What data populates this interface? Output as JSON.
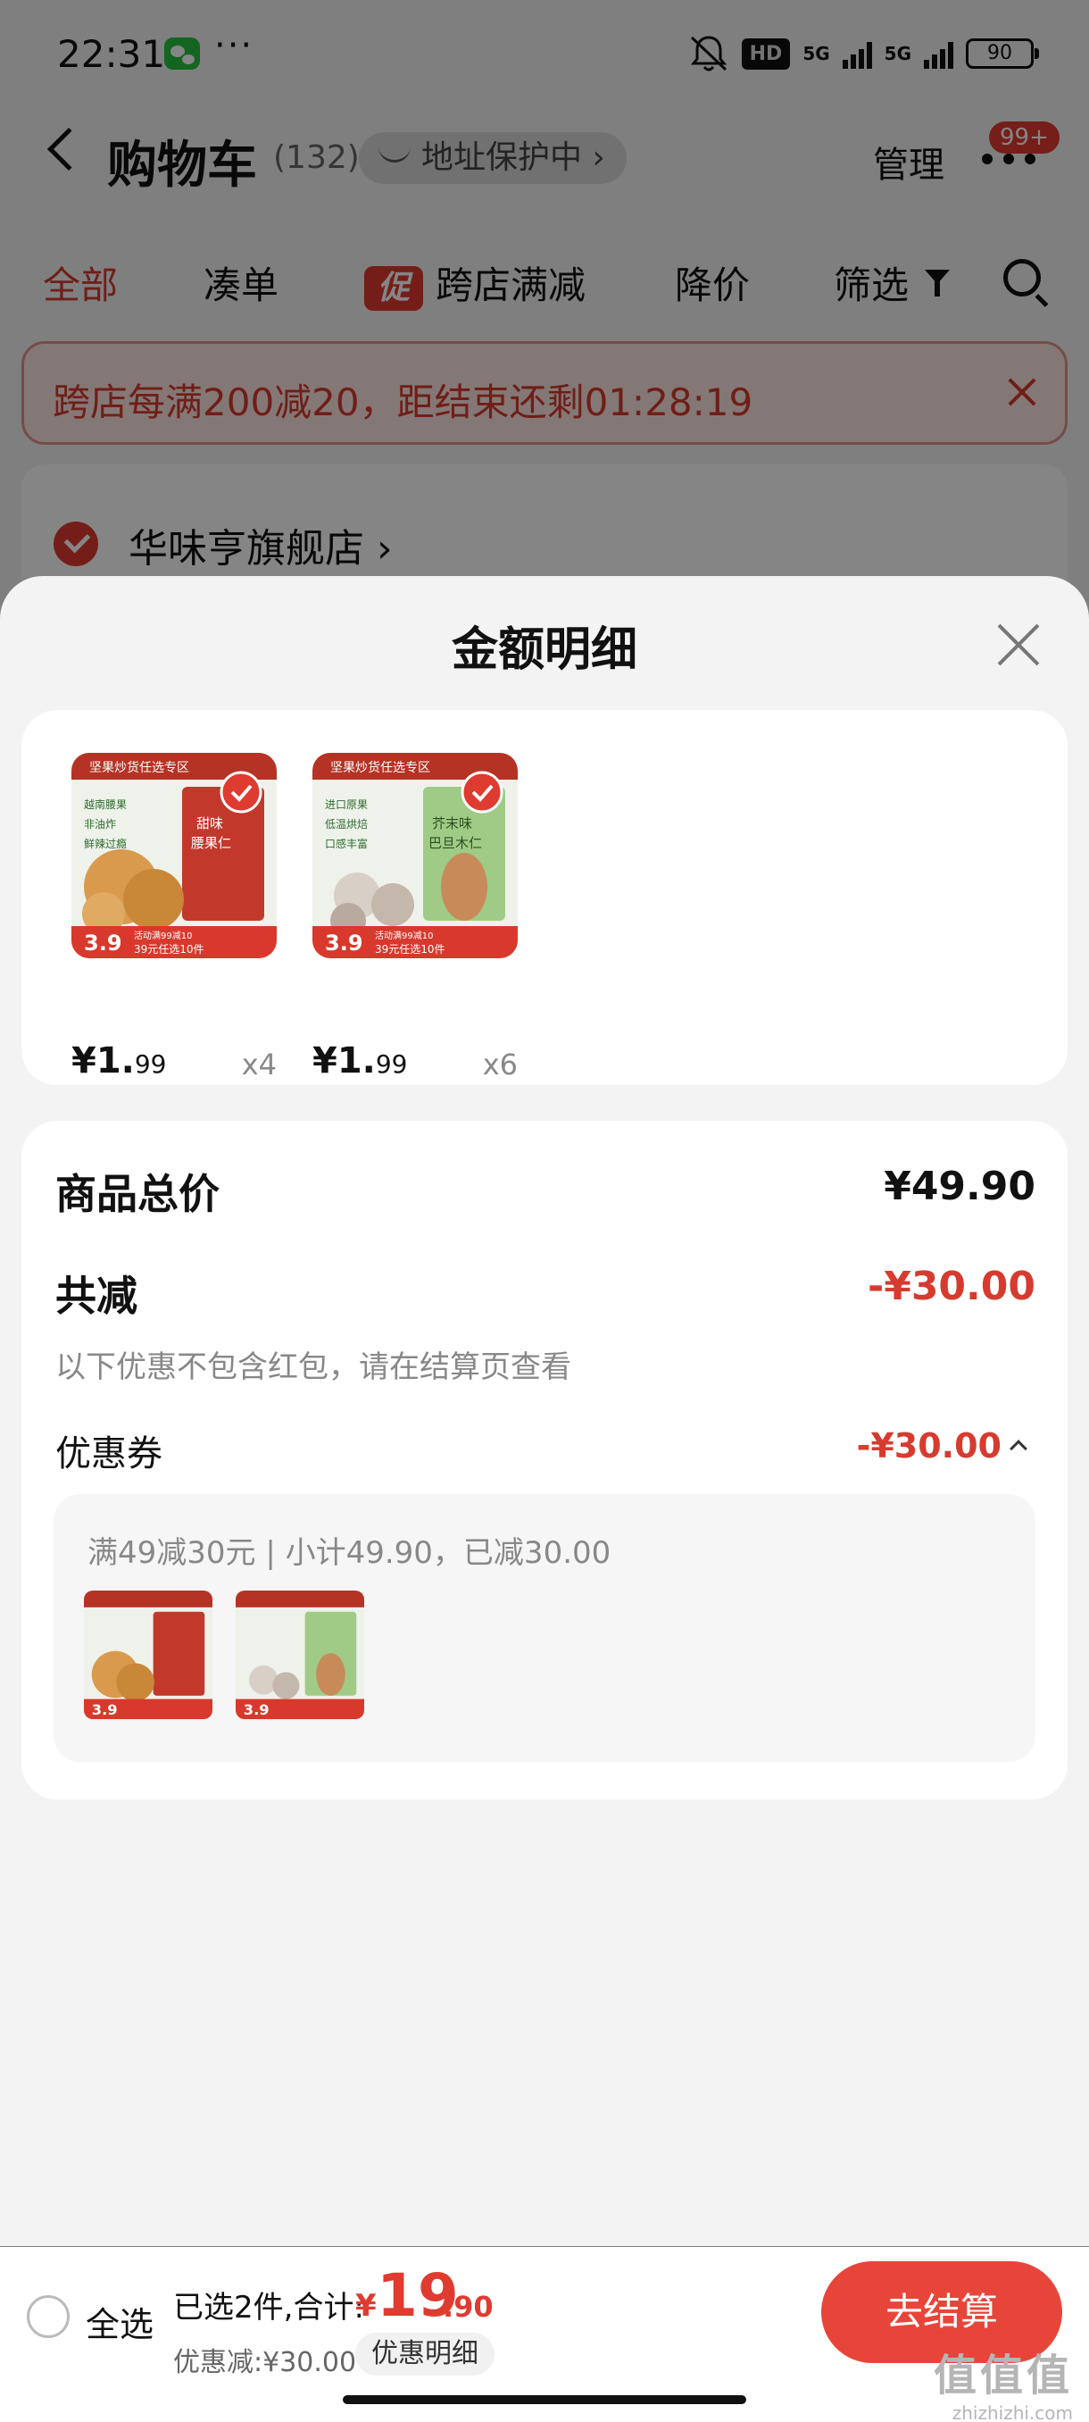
{
  "status_bar": {
    "time": "22:31",
    "dots": "···",
    "hd": "HD",
    "net1": "5G",
    "net2": "5G",
    "battery": "90"
  },
  "nav": {
    "title": "购物车",
    "count": "(132)",
    "address": "地址保护中 ›",
    "manage": "管理",
    "badge": "99+"
  },
  "tabs": [
    {
      "label": "全部"
    },
    {
      "label": "凑单"
    },
    {
      "label": "跨店满减",
      "tag": "促"
    },
    {
      "label": "降价"
    },
    {
      "label": "筛选"
    }
  ],
  "banner": {
    "text": "跨店每满200减20，距结束还剩01:28:19"
  },
  "store": {
    "name": "华味亨旗舰店 ›"
  },
  "sheet": {
    "title": "金额明细",
    "products": [
      {
        "badge": "坚果炒货任选专区",
        "name": "腰果仁",
        "flavor": "甜味",
        "tags": [
          "越南腰果",
          "非油炸",
          "鲜辣过瘾"
        ],
        "price_int": "¥1.",
        "price_dec": "99",
        "qty": "x4",
        "promo_price": "3.9",
        "promo_label": "39元任选10件",
        "promo_sub": "活动满99减10"
      },
      {
        "badge": "坚果炒货任选专区",
        "name": "巴旦木仁",
        "flavor": "芥末味",
        "tags": [
          "进口原果",
          "低温烘焙",
          "口感丰富"
        ],
        "price_int": "¥1.",
        "price_dec": "99",
        "qty": "x6",
        "promo_price": "3.9",
        "promo_label": "39元任选10件",
        "promo_sub": "活动满99减10"
      }
    ],
    "summary": {
      "total_label": "商品总价",
      "total_value": "¥49.90",
      "discount_label": "共减",
      "discount_value": "-¥30.00",
      "note": "以下优惠不包含红包，请在结算页查看",
      "coupon_label": "优惠券",
      "coupon_value": "-¥30.00",
      "coupon_desc": "满49减30元 | 小计49.90，已减30.00"
    }
  },
  "bottom_bar": {
    "select_all": "全选",
    "selected": "已选2件,合计:",
    "currency": "¥",
    "total_int": "19",
    "total_dec": ".90",
    "discount": "优惠减:¥30.00",
    "detail": "优惠明细",
    "checkout": "去结算"
  },
  "watermark": {
    "cn": "值值值",
    "en": "zhizhizhi.com"
  },
  "colors": {
    "accent": "#e03b30",
    "accent_text": "#d63b2f",
    "checkout": "#e8453a",
    "wechat": "#26c23f"
  }
}
